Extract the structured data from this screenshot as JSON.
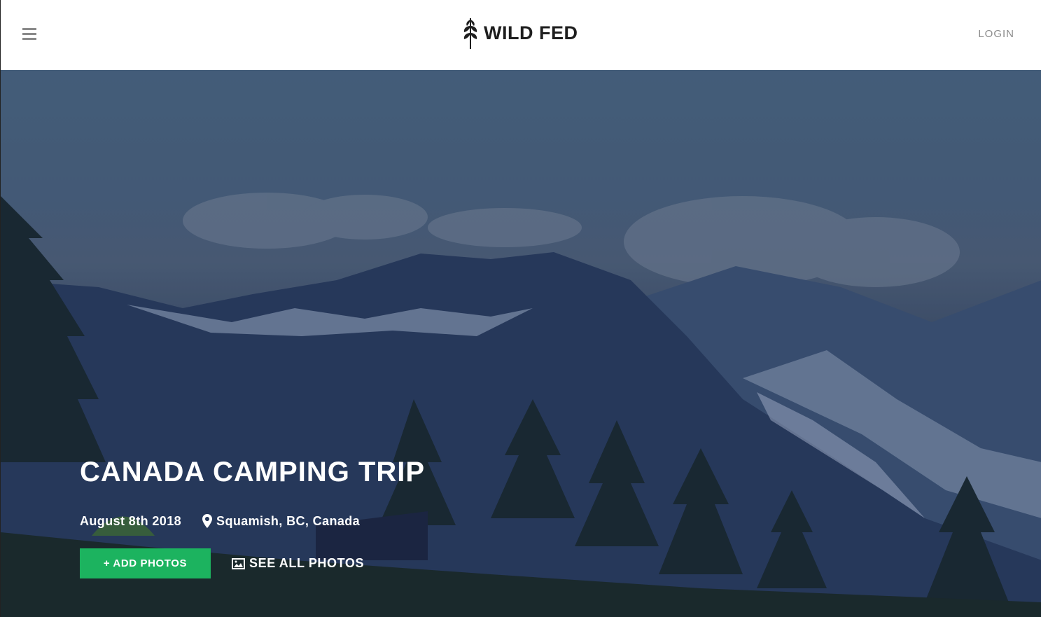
{
  "header": {
    "menu_icon": "hamburger-menu-icon",
    "logo_icon": "leaf-sprig-icon",
    "logo_text": "WILD FED",
    "login_label": "LOGIN"
  },
  "trip": {
    "title": "CANADA CAMPING TRIP",
    "date": "August 8th 2018",
    "location_icon": "map-pin-icon",
    "location": "Squamish, BC, Canada"
  },
  "actions": {
    "add_photos_label": "+ ADD PHOTOS",
    "see_all_icon": "image-icon",
    "see_all_label": "SEE ALL PHOTOS"
  },
  "colors": {
    "accent": "#1cb35f",
    "header_bg": "#ffffff",
    "login_text": "#8a8a8a",
    "logo_text": "#1e1e1e"
  }
}
